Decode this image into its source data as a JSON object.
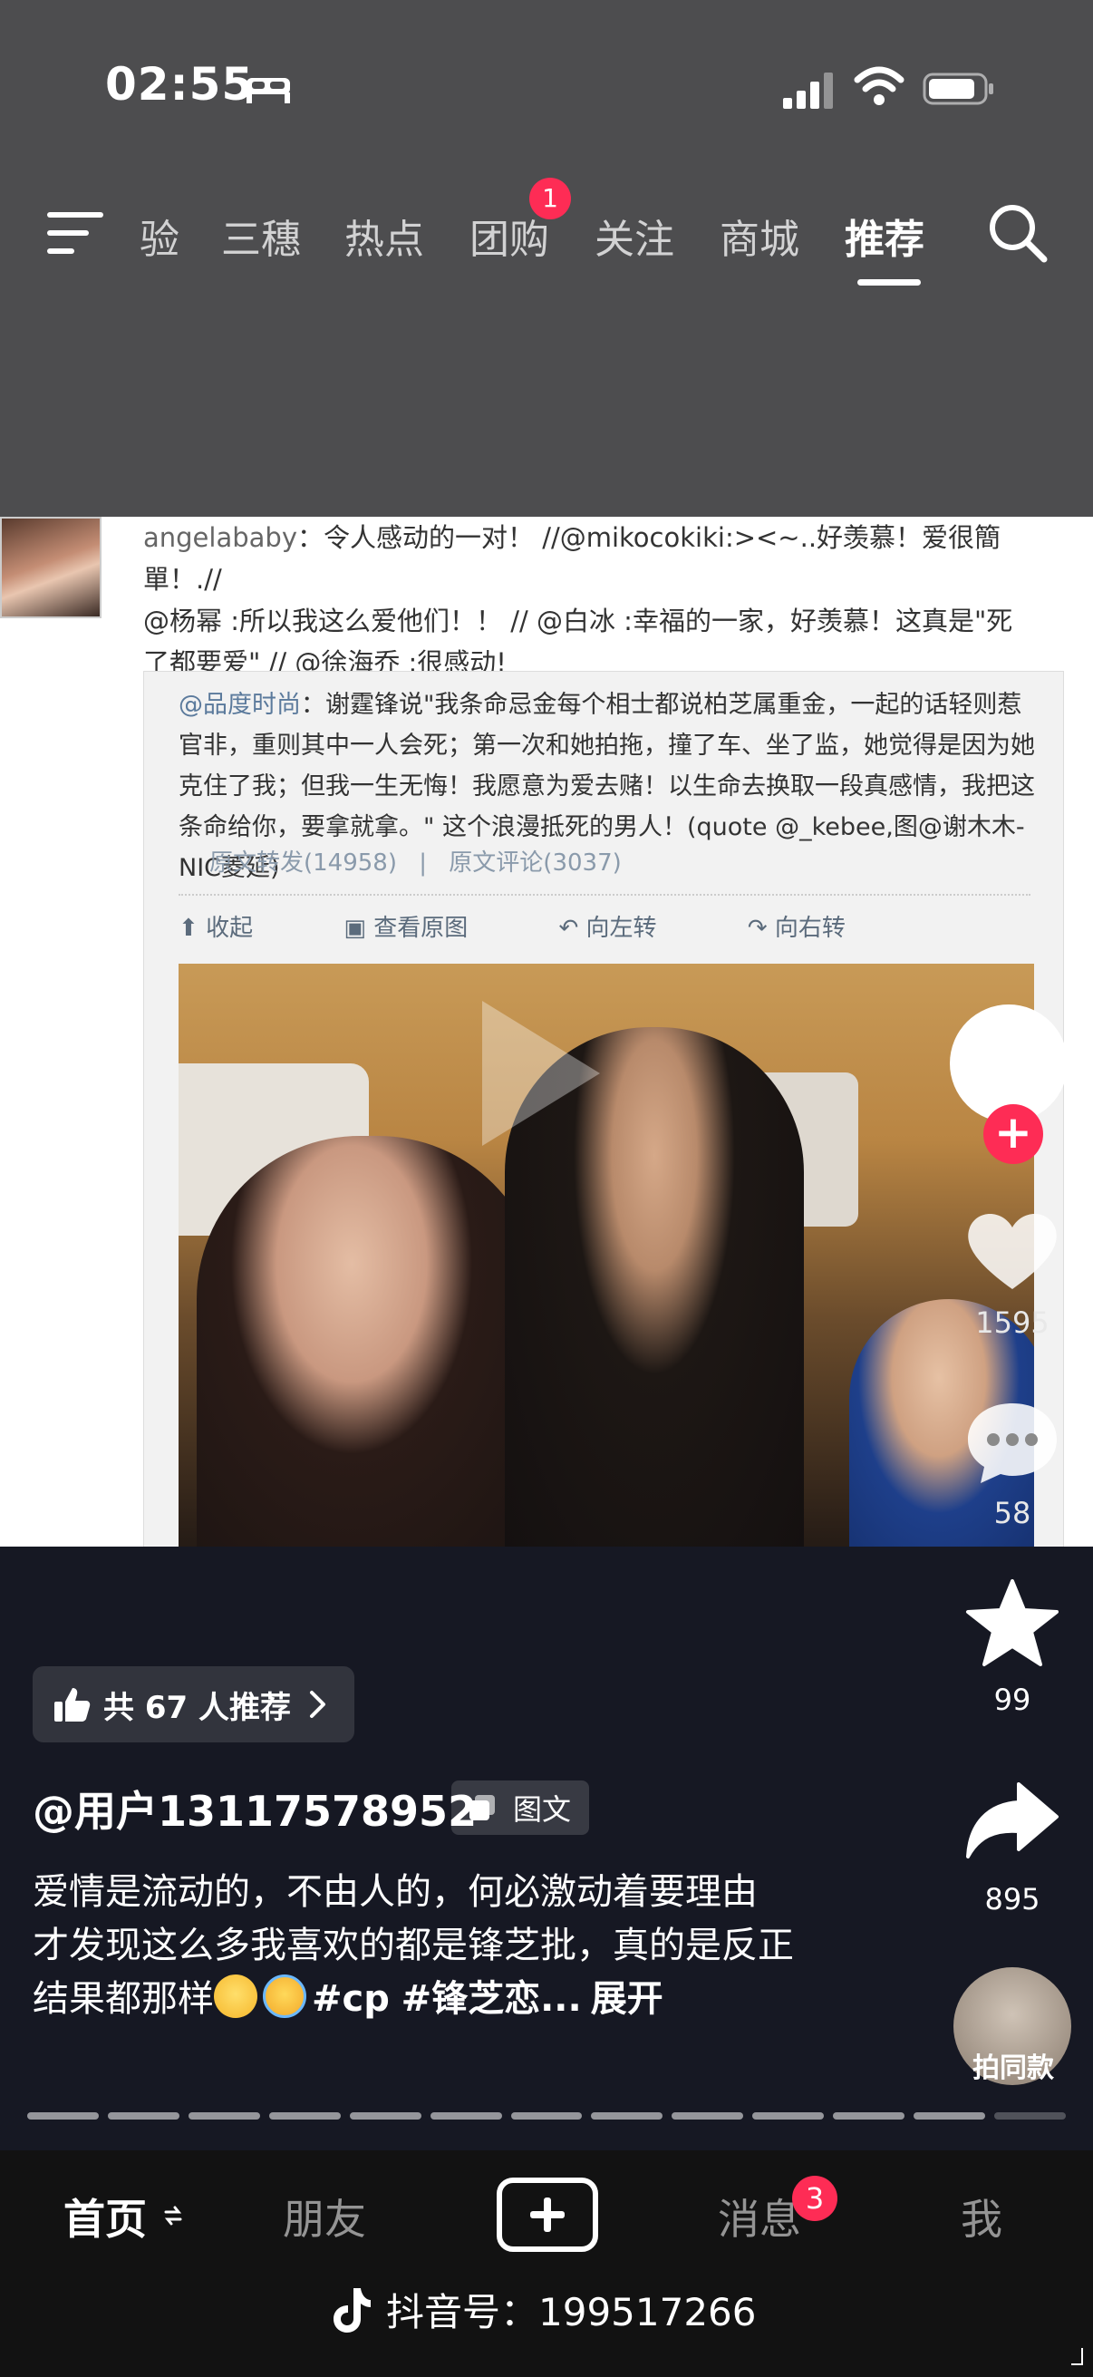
{
  "status_bar": {
    "time": "02:55"
  },
  "top_nav": {
    "tabs": [
      "验",
      "三穗",
      "热点",
      "团购",
      "关注",
      "商城",
      "推荐"
    ],
    "active_tab": "推荐",
    "group_buy_badge": "1"
  },
  "post_image": {
    "line1_user": "angelababy",
    "line1_rest": "：令人感动的一对！ //@mikocokiki:><~..好羡慕！爱很簡單！.//",
    "line2": "@杨幂 :所以我这么爱他们！！ // @白冰 :幸福的一家，好羡慕！这真是\"死",
    "line3": "了都要爱\" // @徐海乔 :很感动!",
    "quote_author": "@品度时尚",
    "quote_text": "：谢霆锋说\"我条命忌金每个相士都说柏芝属重金，一起的话轻则惹官非，重则其中一人会死；第一次和她拍拖，撞了车、坐了监，她觉得是因为她克住了我；但我一生无悔！我愿意为爱去赌！以生命去换取一段真感情，我把这条命给你，要拿就拿。\" 这个浪漫抵死的男人！(quote ",
    "quote_credit": "@_kebee,图@谢木木-NIC菱延)",
    "repost_count": "原文转发(14958)",
    "comment_count": "原文评论(3037)",
    "actions": [
      "收起",
      "查看原图",
      "向左转",
      "向右转"
    ]
  },
  "rail": {
    "likes": "1595",
    "comments": "58",
    "favorites": "99",
    "shares": "895",
    "same_style_label": "拍同款"
  },
  "caption": {
    "recommend_chip": "共 67 人推荐",
    "author": "@用户13117578952",
    "type_tag": "图文",
    "line1": "爱情是流动的，不由人的，何必激动着要理由",
    "line2": "才发现这么多我喜欢的都是锋芝批，真的是反正结果都那样",
    "hashtag1": "#cp",
    "hashtag2": "#锋芝恋...",
    "more": "展开"
  },
  "bottom_nav": {
    "home": "首页",
    "friends": "朋友",
    "messages": "消息",
    "messages_badge": "3",
    "me": "我"
  },
  "watermark": "抖音号：199517266",
  "colors": {
    "accent": "#fe2c55",
    "header_bg": "#4d4d4f",
    "bg": "#161823"
  }
}
